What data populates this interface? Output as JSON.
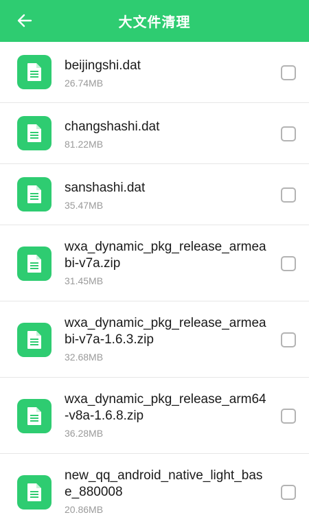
{
  "header": {
    "title": "大文件清理",
    "back_icon": "arrow-left-icon",
    "background": "#2ecc71"
  },
  "files": [
    {
      "name": "beijingshi.dat",
      "size": "26.74MB",
      "checked": false
    },
    {
      "name": "changshashi.dat",
      "size": "81.22MB",
      "checked": false
    },
    {
      "name": "sanshashi.dat",
      "size": "35.47MB",
      "checked": false
    },
    {
      "name": "wxa_dynamic_pkg_release_armeabi-v7a.zip",
      "size": "31.45MB",
      "checked": false
    },
    {
      "name": "wxa_dynamic_pkg_release_armeabi-v7a-1.6.3.zip",
      "size": "32.68MB",
      "checked": false
    },
    {
      "name": "wxa_dynamic_pkg_release_arm64-v8a-1.6.8.zip",
      "size": "36.28MB",
      "checked": false
    },
    {
      "name": "new_qq_android_native_light_base_880008",
      "size": "20.86MB",
      "checked": false
    }
  ],
  "colors": {
    "accent": "#2ecc71",
    "divider": "#e6e6e6",
    "secondary_text": "#9a9a9a"
  }
}
